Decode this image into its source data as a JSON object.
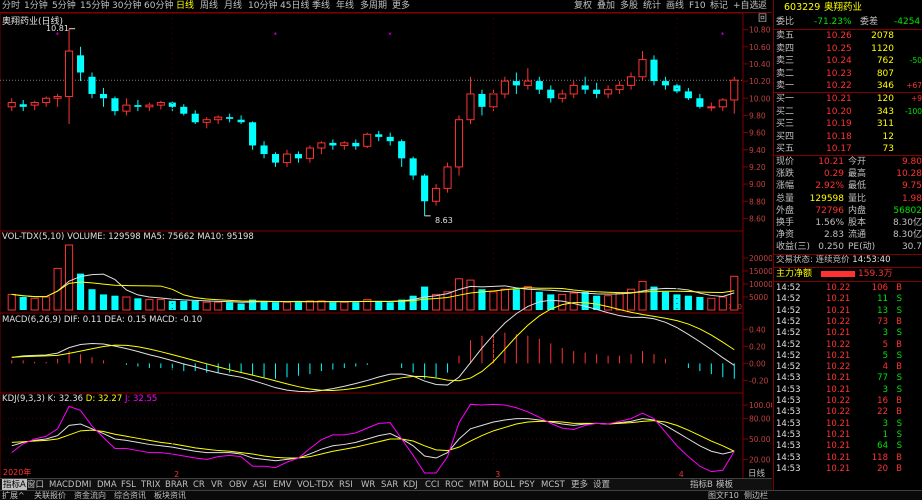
{
  "toolbar": {
    "periods": [
      "分时",
      "1分钟",
      "5分钟",
      "15分钟",
      "30分钟",
      "60分钟",
      "日线",
      "周线",
      "月线",
      "10分钟",
      "45日线",
      "季线",
      "年线",
      "多周期",
      "更多"
    ],
    "active_period_index": 6,
    "right_buttons": [
      "复权",
      "叠加",
      "多股",
      "统计",
      "画线",
      "F10",
      "标记",
      "+自选",
      "返回"
    ]
  },
  "chart_header": {
    "stock_title": "奥翔药业(日线)",
    "vol_label": "VOL-TDX(5,10)",
    "vol_values": "VOLUME: 129598  MA5: 75662  MA10: 95198",
    "macd_label": "MACD(6,26,9)",
    "macd_values": "DIF: 0.11  DEA: 0.15  MACD: -0.10",
    "kdj_label": "KDJ(9,3,3)",
    "kdj_k": "K: 32.36",
    "kdj_d": "D: 32.27",
    "kdj_j": "J: 32.55"
  },
  "price_axis": [
    "10.80",
    "10.60",
    "10.40",
    "10.20",
    "10.00",
    "9.80",
    "9.60",
    "9.40",
    "9.20",
    "9.00",
    "8.80",
    "8.60"
  ],
  "vol_axis": [
    "20000",
    "15000",
    "10000",
    "5000"
  ],
  "vol_unit": "X10",
  "macd_axis": [
    "0.40",
    "0.20",
    "0.00",
    "-0.20"
  ],
  "kdj_axis": [
    "100.00",
    "80.00",
    "50.00",
    "20.00"
  ],
  "annotations": {
    "high": "10.81",
    "low": "8.63"
  },
  "date_label": "2020年",
  "date_marks": [
    "2",
    "3",
    "4"
  ],
  "period_label_bottom": "日线",
  "chart_data": {
    "type": "candlestick",
    "ylim": [
      8.5,
      10.9
    ],
    "ohlc": [
      [
        9.9,
        10.0,
        9.85,
        9.95
      ],
      [
        9.93,
        9.98,
        9.85,
        9.9
      ],
      [
        9.92,
        9.97,
        9.86,
        9.95
      ],
      [
        9.95,
        10.02,
        9.9,
        10.0
      ],
      [
        10.0,
        10.05,
        9.9,
        10.02
      ],
      [
        10.02,
        10.81,
        9.7,
        10.55
      ],
      [
        10.5,
        10.6,
        10.2,
        10.3
      ],
      [
        10.25,
        10.3,
        10.0,
        10.05
      ],
      [
        10.05,
        10.12,
        9.9,
        10.0
      ],
      [
        10.0,
        10.02,
        9.8,
        9.85
      ],
      [
        9.85,
        10.0,
        9.8,
        9.92
      ],
      [
        9.92,
        9.98,
        9.85,
        9.9
      ],
      [
        9.9,
        9.95,
        9.85,
        9.92
      ],
      [
        9.92,
        9.97,
        9.87,
        9.95
      ],
      [
        9.95,
        9.96,
        9.85,
        9.9
      ],
      [
        9.9,
        9.93,
        9.8,
        9.82
      ],
      [
        9.82,
        9.86,
        9.7,
        9.72
      ],
      [
        9.72,
        9.78,
        9.65,
        9.75
      ],
      [
        9.75,
        9.8,
        9.7,
        9.78
      ],
      [
        9.78,
        9.82,
        9.72,
        9.76
      ],
      [
        9.75,
        9.8,
        9.7,
        9.72
      ],
      [
        9.72,
        9.73,
        9.4,
        9.45
      ],
      [
        9.45,
        9.5,
        9.3,
        9.35
      ],
      [
        9.35,
        9.37,
        9.2,
        9.25
      ],
      [
        9.25,
        9.4,
        9.2,
        9.35
      ],
      [
        9.35,
        9.38,
        9.25,
        9.3
      ],
      [
        9.3,
        9.45,
        9.25,
        9.42
      ],
      [
        9.42,
        9.5,
        9.35,
        9.48
      ],
      [
        9.48,
        9.52,
        9.4,
        9.45
      ],
      [
        9.45,
        9.5,
        9.4,
        9.48
      ],
      [
        9.48,
        9.52,
        9.4,
        9.44
      ],
      [
        9.44,
        9.6,
        9.42,
        9.58
      ],
      [
        9.58,
        9.62,
        9.5,
        9.55
      ],
      [
        9.55,
        9.6,
        9.45,
        9.5
      ],
      [
        9.5,
        9.52,
        9.2,
        9.3
      ],
      [
        9.3,
        9.32,
        9.05,
        9.1
      ],
      [
        9.1,
        9.12,
        8.63,
        8.8
      ],
      [
        8.8,
        9.0,
        8.75,
        8.95
      ],
      [
        8.95,
        9.25,
        8.9,
        9.2
      ],
      [
        9.2,
        9.8,
        9.1,
        9.75
      ],
      [
        9.75,
        10.25,
        9.7,
        10.05
      ],
      [
        10.05,
        10.1,
        9.8,
        9.9
      ],
      [
        9.9,
        10.1,
        9.85,
        10.05
      ],
      [
        10.05,
        10.25,
        10.0,
        10.2
      ],
      [
        10.2,
        10.3,
        10.05,
        10.15
      ],
      [
        10.15,
        10.35,
        10.1,
        10.2
      ],
      [
        10.2,
        10.25,
        10.05,
        10.1
      ],
      [
        10.1,
        10.15,
        9.95,
        10.0
      ],
      [
        10.0,
        10.1,
        9.95,
        10.05
      ],
      [
        10.05,
        10.2,
        10.0,
        10.15
      ],
      [
        10.15,
        10.25,
        10.05,
        10.1
      ],
      [
        10.1,
        10.18,
        10.0,
        10.05
      ],
      [
        10.05,
        10.15,
        10.0,
        10.1
      ],
      [
        10.1,
        10.2,
        10.05,
        10.15
      ],
      [
        10.15,
        10.3,
        10.1,
        10.25
      ],
      [
        10.25,
        10.55,
        10.2,
        10.45
      ],
      [
        10.45,
        10.5,
        10.15,
        10.2
      ],
      [
        10.2,
        10.25,
        10.1,
        10.15
      ],
      [
        10.15,
        10.18,
        10.05,
        10.08
      ],
      [
        10.08,
        10.12,
        9.98,
        10.0
      ],
      [
        10.0,
        10.05,
        9.88,
        9.9
      ],
      [
        9.9,
        9.95,
        9.85,
        9.9
      ],
      [
        9.9,
        10.0,
        9.85,
        9.98
      ],
      [
        9.98,
        10.25,
        9.82,
        10.21
      ]
    ],
    "volumes": [
      6000,
      5000,
      4500,
      5000,
      16000,
      25000,
      14000,
      8000,
      6000,
      5500,
      5000,
      4500,
      4000,
      4000,
      3500,
      3500,
      3500,
      3000,
      3000,
      3000,
      2500,
      4000,
      3500,
      3000,
      3000,
      3000,
      3500,
      3500,
      3000,
      3000,
      3000,
      4000,
      3500,
      3000,
      4000,
      5500,
      9000,
      6000,
      7000,
      12000,
      11500,
      8000,
      7000,
      8000,
      8000,
      9000,
      7000,
      6000,
      6000,
      6500,
      7000,
      5500,
      5500,
      6500,
      8000,
      11000,
      9000,
      7000,
      6000,
      5500,
      5000,
      4500,
      5000,
      12959
    ],
    "macd_hist": [
      0.02,
      0.02,
      0.01,
      0.01,
      0.03,
      0.08,
      0.06,
      0.04,
      0.02,
      0.0,
      -0.01,
      -0.02,
      -0.03,
      -0.03,
      -0.04,
      -0.05,
      -0.05,
      -0.06,
      -0.06,
      -0.06,
      -0.06,
      -0.08,
      -0.09,
      -0.1,
      -0.09,
      -0.08,
      -0.07,
      -0.05,
      -0.04,
      -0.03,
      -0.02,
      -0.01,
      0.0,
      0.0,
      -0.03,
      -0.06,
      -0.1,
      -0.09,
      -0.06,
      0.05,
      0.15,
      0.18,
      0.19,
      0.2,
      0.19,
      0.18,
      0.16,
      0.13,
      0.1,
      0.08,
      0.07,
      0.06,
      0.05,
      0.05,
      0.06,
      0.08,
      0.06,
      0.03,
      0.0,
      -0.03,
      -0.05,
      -0.07,
      -0.09,
      -0.1
    ],
    "kdj_k": [
      40,
      45,
      48,
      50,
      55,
      70,
      72,
      65,
      58,
      50,
      48,
      45,
      42,
      40,
      38,
      35,
      32,
      30,
      30,
      30,
      28,
      22,
      20,
      18,
      20,
      22,
      28,
      35,
      40,
      42,
      45,
      50,
      55,
      58,
      50,
      40,
      25,
      22,
      30,
      50,
      65,
      70,
      75,
      78,
      80,
      80,
      78,
      75,
      72,
      70,
      72,
      73,
      72,
      74,
      76,
      80,
      78,
      70,
      60,
      50,
      40,
      32,
      28,
      32
    ],
    "kdj_d": [
      45,
      46,
      47,
      48,
      50,
      56,
      62,
      63,
      61,
      57,
      54,
      51,
      48,
      45,
      43,
      40,
      37,
      35,
      33,
      32,
      30,
      28,
      25,
      23,
      22,
      22,
      24,
      28,
      32,
      35,
      38,
      42,
      46,
      50,
      50,
      47,
      40,
      34,
      33,
      38,
      47,
      55,
      62,
      67,
      72,
      75,
      76,
      76,
      75,
      73,
      73,
      73,
      72,
      73,
      74,
      76,
      77,
      75,
      70,
      63,
      55,
      47,
      40,
      32
    ]
  },
  "quote": {
    "code": "603229",
    "name": "奥翔药业",
    "wei_bi_label": "委比",
    "wei_bi": "-71.23%",
    "wei_cha_label": "委差",
    "wei_cha": "-4254",
    "sells": [
      {
        "label": "卖五",
        "price": "10.26",
        "vol": "2078",
        "chg": ""
      },
      {
        "label": "卖四",
        "price": "10.25",
        "vol": "1120",
        "chg": ""
      },
      {
        "label": "卖三",
        "price": "10.24",
        "vol": "762",
        "chg": "-50"
      },
      {
        "label": "卖二",
        "price": "10.23",
        "vol": "807",
        "chg": ""
      },
      {
        "label": "卖一",
        "price": "10.22",
        "vol": "346",
        "chg": "+67"
      }
    ],
    "buys": [
      {
        "label": "买一",
        "price": "10.21",
        "vol": "120",
        "chg": "+9"
      },
      {
        "label": "买二",
        "price": "10.20",
        "vol": "343",
        "chg": "-100"
      },
      {
        "label": "买三",
        "price": "10.19",
        "vol": "311",
        "chg": ""
      },
      {
        "label": "买四",
        "price": "10.18",
        "vol": "12",
        "chg": ""
      },
      {
        "label": "买五",
        "price": "10.17",
        "vol": "73",
        "chg": ""
      }
    ],
    "stats": [
      {
        "l1": "现价",
        "v1": "10.21",
        "l2": "今开",
        "v2": "9.80"
      },
      {
        "l1": "涨跌",
        "v1": "0.29",
        "l2": "最高",
        "v2": "10.28"
      },
      {
        "l1": "涨幅",
        "v1": "2.92%",
        "l2": "最低",
        "v2": "9.75"
      },
      {
        "l1": "总量",
        "v1": "129598",
        "l2": "量比",
        "v2": "1.98"
      },
      {
        "l1": "外盘",
        "v1": "72796",
        "l2": "内盘",
        "v2": "56802"
      },
      {
        "l1": "换手",
        "v1": "1.56%",
        "l2": "股本",
        "v2": "8.30亿"
      },
      {
        "l1": "净资",
        "v1": "2.83",
        "l2": "流通",
        "v2": "8.30亿"
      },
      {
        "l1": "收益(三)",
        "v1": "0.250",
        "l2": "PE(动)",
        "v2": "30.7"
      }
    ],
    "trade_status_label": "交易状态:",
    "trade_status": "连续竞价",
    "trade_time": "14:53:40",
    "main_flow_label": "主力净额",
    "main_flow_value": "159.3万"
  },
  "ticks": [
    {
      "t": "14:52",
      "p": "10.22",
      "v": "106",
      "s": "B"
    },
    {
      "t": "14:52",
      "p": "10.21",
      "v": "11",
      "s": "S"
    },
    {
      "t": "14:52",
      "p": "10.21",
      "v": "13",
      "s": "S"
    },
    {
      "t": "14:52",
      "p": "10.22",
      "v": "73",
      "s": "B"
    },
    {
      "t": "14:52",
      "p": "10.21",
      "v": "3",
      "s": "S"
    },
    {
      "t": "14:52",
      "p": "10.22",
      "v": "5",
      "s": "B"
    },
    {
      "t": "14:52",
      "p": "10.21",
      "v": "5",
      "s": "S"
    },
    {
      "t": "14:52",
      "p": "10.22",
      "v": "4",
      "s": "B"
    },
    {
      "t": "14:53",
      "p": "10.21",
      "v": "77",
      "s": "S"
    },
    {
      "t": "14:53",
      "p": "10.21",
      "v": "3",
      "s": "S"
    },
    {
      "t": "14:53",
      "p": "10.22",
      "v": "16",
      "s": "B"
    },
    {
      "t": "14:53",
      "p": "10.22",
      "v": "22",
      "s": "B"
    },
    {
      "t": "14:53",
      "p": "10.21",
      "v": "3",
      "s": "S"
    },
    {
      "t": "14:53",
      "p": "10.21",
      "v": "1",
      "s": "S"
    },
    {
      "t": "14:53",
      "p": "10.21",
      "v": "64",
      "s": "S"
    },
    {
      "t": "14:53",
      "p": "10.21",
      "v": "118",
      "s": "B"
    },
    {
      "t": "14:53",
      "p": "10.21",
      "v": "20",
      "s": "B"
    }
  ],
  "indicator_tabs": [
    "指标A",
    "窗口",
    "MACD",
    "DMI",
    "DMA",
    "FSL",
    "TRIX",
    "BRAR",
    "CR",
    "VR",
    "OBV",
    "ASI",
    "EMV",
    "VOL-TDX",
    "RSI",
    "WR",
    "SAR",
    "KDJ",
    "CCI",
    "ROC",
    "MTM",
    "BOLL",
    "PSY",
    "MCST",
    "更多",
    "设置"
  ],
  "indicator_right": [
    "指标B",
    "模板"
  ],
  "status_tabs": [
    "扩展^",
    "关联报价",
    "资金流向",
    "综合资讯",
    "板块资讯"
  ],
  "status_right": [
    "图文F10",
    "侧边栏"
  ]
}
